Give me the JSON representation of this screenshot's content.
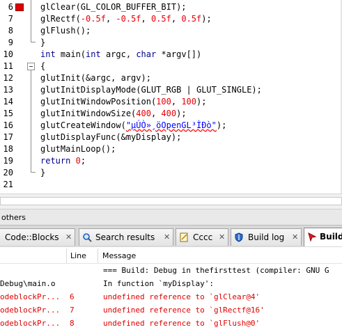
{
  "editor": {
    "lines": [
      {
        "n": "6",
        "bp": true,
        "html": [
          [
            "plain",
            "glClear(GL_COLOR_BUFFER_BIT);"
          ]
        ]
      },
      {
        "n": "7",
        "html": [
          [
            "plain",
            "glRectf("
          ],
          [
            "op",
            "-"
          ],
          [
            "num",
            "0.5f"
          ],
          [
            "plain",
            ", "
          ],
          [
            "op",
            "-"
          ],
          [
            "num",
            "0.5f"
          ],
          [
            "plain",
            ", "
          ],
          [
            "num",
            "0.5f"
          ],
          [
            "plain",
            ", "
          ],
          [
            "num",
            "0.5f"
          ],
          [
            "plain",
            ");"
          ]
        ]
      },
      {
        "n": "8",
        "html": [
          [
            "plain",
            "glFlush();"
          ]
        ]
      },
      {
        "n": "9",
        "html": [
          [
            "plain",
            "}"
          ]
        ]
      },
      {
        "n": "10",
        "html": [
          [
            "kw",
            "int"
          ],
          [
            "plain",
            " main("
          ],
          [
            "kw",
            "int"
          ],
          [
            "plain",
            " argc, "
          ],
          [
            "kw",
            "char"
          ],
          [
            "plain",
            " *argv[])"
          ]
        ]
      },
      {
        "n": "11",
        "html": [
          [
            "plain",
            "{"
          ]
        ]
      },
      {
        "n": "12",
        "html": [
          [
            "plain",
            "glutInit(&argc, argv);"
          ]
        ]
      },
      {
        "n": "13",
        "html": [
          [
            "plain",
            "glutInitDisplayMode(GLUT_RGB | GLUT_SINGLE);"
          ]
        ]
      },
      {
        "n": "14",
        "html": [
          [
            "plain",
            "glutInitWindowPosition("
          ],
          [
            "num",
            "100"
          ],
          [
            "plain",
            ", "
          ],
          [
            "num",
            "100"
          ],
          [
            "plain",
            ");"
          ]
        ]
      },
      {
        "n": "15",
        "html": [
          [
            "plain",
            "glutInitWindowSize("
          ],
          [
            "num",
            "400"
          ],
          [
            "plain",
            ", "
          ],
          [
            "num",
            "400"
          ],
          [
            "plain",
            ");"
          ]
        ]
      },
      {
        "n": "16",
        "html": [
          [
            "plain",
            "glutCreateWindow("
          ],
          [
            "strsq",
            "\"µÚÒ»¸öOpenGL³ÌÐò\""
          ],
          [
            "plain",
            ");"
          ]
        ]
      },
      {
        "n": "17",
        "html": [
          [
            "plain",
            "glutDisplayFunc(&myDisplay);"
          ]
        ]
      },
      {
        "n": "18",
        "html": [
          [
            "plain",
            "glutMainLoop();"
          ]
        ]
      },
      {
        "n": "19",
        "html": [
          [
            "kw",
            "return"
          ],
          [
            "plain",
            " "
          ],
          [
            "num",
            "0"
          ],
          [
            "plain",
            ";"
          ]
        ]
      },
      {
        "n": "20",
        "html": [
          [
            "plain",
            "}"
          ]
        ]
      },
      {
        "n": "21",
        "html": []
      }
    ]
  },
  "panel": {
    "caption": "others",
    "tabs": [
      {
        "label": "Code::Blocks",
        "icon": "codeblocks-icon"
      },
      {
        "label": "Search results",
        "icon": "search-icon"
      },
      {
        "label": "Cccc",
        "icon": "notepad-icon"
      },
      {
        "label": "Build log",
        "icon": "shield-icon"
      },
      {
        "label": "Build",
        "icon": "build-messages-icon"
      }
    ],
    "columns": {
      "file": "",
      "line": "Line",
      "message": "Message"
    },
    "rows": [
      {
        "file": "",
        "line": "",
        "message": "=== Build: Debug in thefirsttest (compiler: GNU G",
        "error": false
      },
      {
        "file": "Debug\\main.o",
        "line": "",
        "message": "In function `myDisplay':",
        "error": false
      },
      {
        "file": "odeblockPr...",
        "line": "6",
        "message": "undefined reference to `glClear@4'",
        "error": true
      },
      {
        "file": "odeblockPr...",
        "line": "7",
        "message": "undefined reference to `glRectf@16'",
        "error": true
      },
      {
        "file": "odeblockPr...",
        "line": "8",
        "message": "undefined reference to `glFlush@0'",
        "error": true
      }
    ]
  },
  "colors": {
    "error": "#e00000",
    "keyword": "#00008b",
    "number": "#e5000a",
    "string": "#0000ff"
  }
}
